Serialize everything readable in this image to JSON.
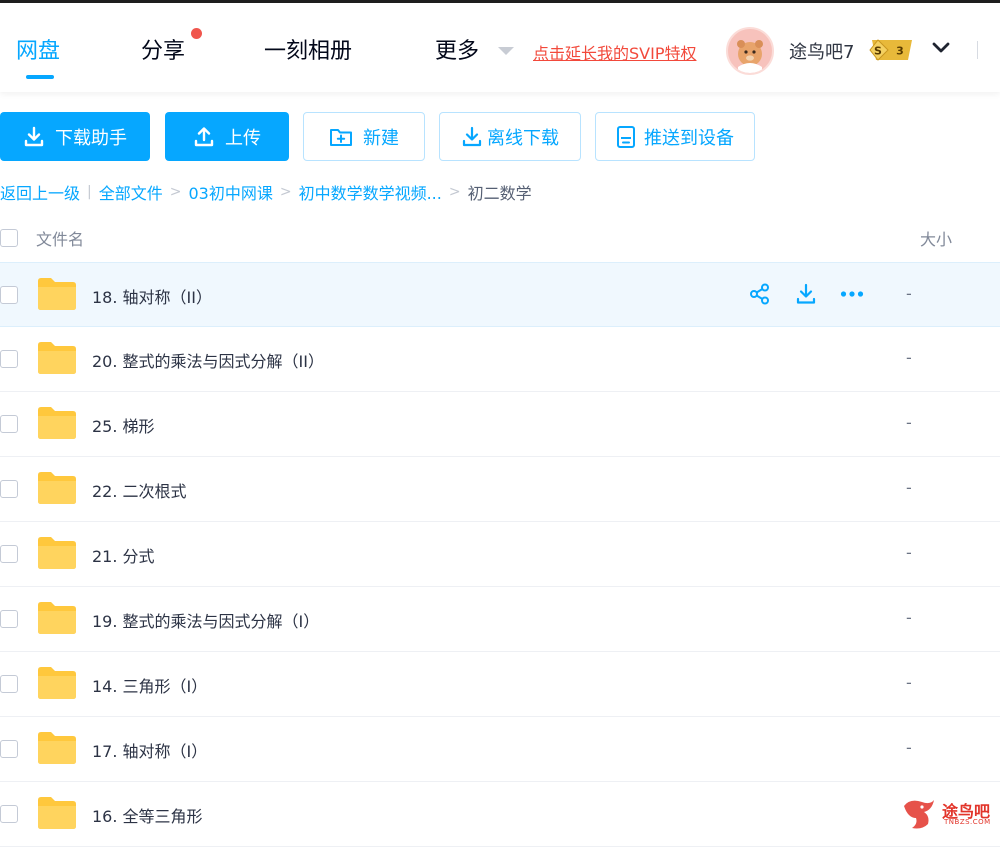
{
  "header": {
    "nav": [
      {
        "label": "网盘",
        "active": true
      },
      {
        "label": "分享",
        "has_dot": true
      },
      {
        "label": "一刻相册"
      },
      {
        "label": "更多"
      }
    ],
    "svip_promo": "点击延长我的SVIP特权",
    "username": "途鸟吧7",
    "badge": {
      "letter": "S",
      "level": "3"
    }
  },
  "toolbar": {
    "download_helper": "下载助手",
    "upload": "上传",
    "new_folder": "新建",
    "offline_download": "离线下载",
    "push_to_device": "推送到设备"
  },
  "breadcrumb": {
    "back": "返回上一级",
    "divider": "|",
    "items": [
      "全部文件",
      "03初中网课",
      "初中数学数学视频..."
    ],
    "separator": ">",
    "current": "初二数学"
  },
  "columns": {
    "name": "文件名",
    "size": "大小"
  },
  "files": [
    {
      "name": "18. 轴对称（II）",
      "size": "-"
    },
    {
      "name": "20. 整式的乘法与因式分解（II）",
      "size": "-"
    },
    {
      "name": "25. 梯形",
      "size": "-"
    },
    {
      "name": "22. 二次根式",
      "size": "-"
    },
    {
      "name": "21. 分式",
      "size": "-"
    },
    {
      "name": "19. 整式的乘法与因式分解（I）",
      "size": "-"
    },
    {
      "name": "14. 三角形（I）",
      "size": "-"
    },
    {
      "name": "17. 轴对称（I）",
      "size": "-"
    },
    {
      "name": "16. 全等三角形",
      "size": "-"
    }
  ],
  "watermark": {
    "text": "途鸟吧",
    "sub": "TNBZS.COM"
  },
  "colors": {
    "accent": "#06a7ff",
    "promo": "#f2493b",
    "folder": "#ffc83d"
  }
}
